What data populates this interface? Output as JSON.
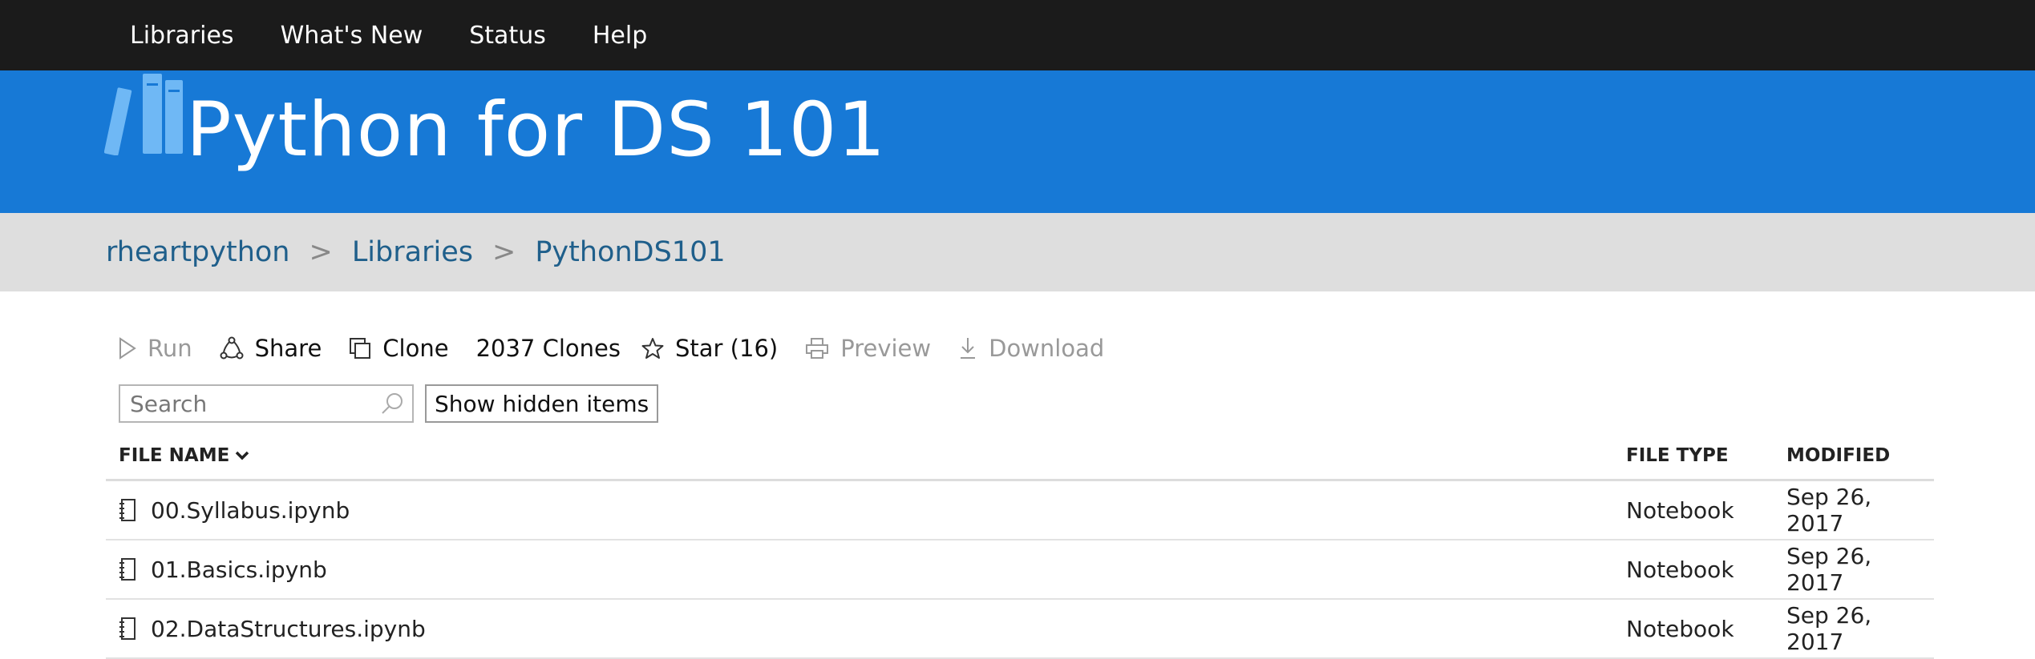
{
  "nav": {
    "items": [
      "Libraries",
      "What's New",
      "Status",
      "Help"
    ]
  },
  "banner": {
    "title": "Python for DS 101"
  },
  "breadcrumb": {
    "items": [
      "rheartpython",
      "Libraries",
      "PythonDS101"
    ],
    "separator": ">"
  },
  "toolbar": {
    "run_label": "Run",
    "share_label": "Share",
    "clone_label": "Clone",
    "clones_count": "2037 Clones",
    "star_label": "Star (16)",
    "preview_label": "Preview",
    "download_label": "Download"
  },
  "search": {
    "placeholder": "Search",
    "show_hidden_label": "Show hidden items"
  },
  "table": {
    "columns": {
      "name": "FILE NAME",
      "type": "FILE TYPE",
      "modified": "MODIFIED"
    },
    "rows": [
      {
        "name": "00.Syllabus.ipynb",
        "type": "Notebook",
        "modified": "Sep 26, 2017"
      },
      {
        "name": "01.Basics.ipynb",
        "type": "Notebook",
        "modified": "Sep 26, 2017"
      },
      {
        "name": "02.DataStructures.ipynb",
        "type": "Notebook",
        "modified": "Sep 26, 2017"
      }
    ]
  },
  "colors": {
    "topnav_bg": "#1b1b1b",
    "banner_bg": "#1779d6",
    "breadcrumb_bg": "#dedede",
    "link": "#1f5f8b"
  },
  "icons": [
    "books-logo-icon",
    "play-icon",
    "share-icon",
    "clone-icon",
    "star-icon",
    "print-icon",
    "download-icon",
    "search-icon",
    "chevron-down-icon",
    "notebook-icon"
  ]
}
